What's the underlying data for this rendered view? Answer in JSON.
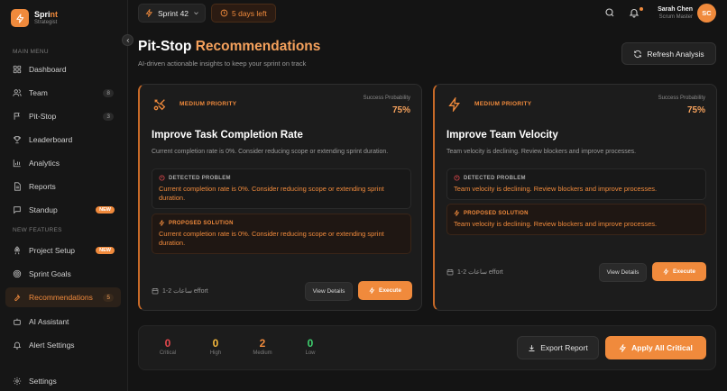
{
  "app": {
    "name_part1": "Spri",
    "name_part2": "nt",
    "subtitle": "Strategist"
  },
  "sidebar": {
    "main_menu_label": "MAIN MENU",
    "new_features_label": "NEW FEATURES",
    "items": [
      {
        "label": "Dashboard",
        "icon": "grid-icon"
      },
      {
        "label": "Team",
        "icon": "users-icon",
        "count": "8"
      },
      {
        "label": "Pit-Stop",
        "icon": "flag-icon",
        "count": "3"
      },
      {
        "label": "Leaderboard",
        "icon": "trophy-icon"
      },
      {
        "label": "Analytics",
        "icon": "bar-chart-icon"
      },
      {
        "label": "Reports",
        "icon": "document-icon"
      },
      {
        "label": "Standup",
        "icon": "chat-icon",
        "badge": "NEW"
      },
      {
        "label": "Project Setup",
        "icon": "rocket-icon",
        "badge": "NEW"
      },
      {
        "label": "Sprint Goals",
        "icon": "target-icon"
      },
      {
        "label": "Recommendations",
        "icon": "wrench-icon",
        "count": "5"
      },
      {
        "label": "AI Assistant",
        "icon": "bot-icon"
      },
      {
        "label": "Alert Settings",
        "icon": "bell-icon"
      },
      {
        "label": "Settings",
        "icon": "gear-icon"
      }
    ]
  },
  "topbar": {
    "sprint": "Sprint 42",
    "days_left": "5 days left",
    "user_name": "Sarah Chen",
    "user_role": "Scrum Master",
    "avatar_initials": "SC"
  },
  "header": {
    "title_plain": "Pit-Stop ",
    "title_accent": "Recommendations",
    "subtitle": "AI-driven actionable insights to keep your sprint on track",
    "refresh_label": "Refresh Analysis"
  },
  "cards": [
    {
      "icon": "tools-icon",
      "priority": "MEDIUM PRIORITY",
      "prob_label": "Success Probability",
      "prob_value": "75%",
      "title": "Improve Task Completion Rate",
      "description": "Current completion rate is 0%. Consider reducing scope or extending sprint duration.",
      "problem_label": "DETECTED PROBLEM",
      "problem_text": "Current completion rate is 0%. Consider reducing scope or extending sprint duration.",
      "solution_label": "PROPOSED SOLUTION",
      "solution_text": "Current completion rate is 0%. Consider reducing scope or extending sprint duration.",
      "effort": "1-2 ساعات effort",
      "details_label": "View Details",
      "execute_label": "Execute"
    },
    {
      "icon": "lightning-icon",
      "priority": "MEDIUM PRIORITY",
      "prob_label": "Success Probability",
      "prob_value": "75%",
      "title": "Improve Team Velocity",
      "description": "Team velocity is declining. Review blockers and improve processes.",
      "problem_label": "DETECTED PROBLEM",
      "problem_text": "Team velocity is declining. Review blockers and improve processes.",
      "solution_label": "PROPOSED SOLUTION",
      "solution_text": "Team velocity is declining. Review blockers and improve processes.",
      "effort": "1-2 ساعات effort",
      "details_label": "View Details",
      "execute_label": "Execute"
    }
  ],
  "summary": {
    "stats": [
      {
        "value": "0",
        "label": "Critical",
        "color": "#e5484d"
      },
      {
        "value": "0",
        "label": "High",
        "color": "#f5b83d"
      },
      {
        "value": "2",
        "label": "Medium",
        "color": "#f08a3c"
      },
      {
        "value": "0",
        "label": "Low",
        "color": "#3ecf6e"
      }
    ],
    "export_label": "Export Report",
    "apply_label": "Apply All Critical"
  },
  "colors": {
    "accent": "#f08a3c",
    "background": "#141414",
    "card": "#1c1c1c"
  }
}
